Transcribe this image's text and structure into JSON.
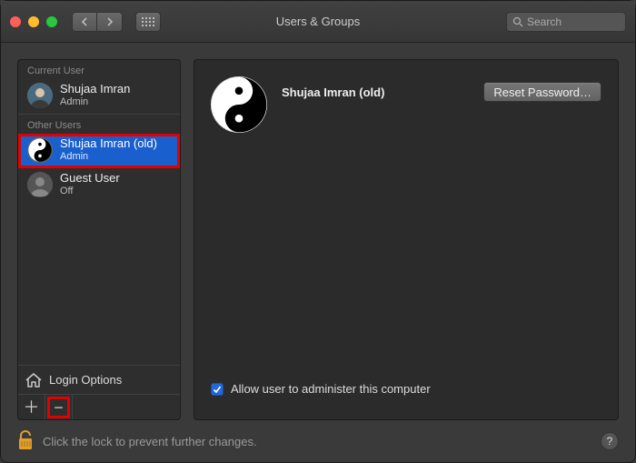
{
  "window": {
    "title": "Users & Groups"
  },
  "toolbar": {
    "search_placeholder": "Search"
  },
  "sidebar": {
    "current_header": "Current User",
    "other_header": "Other Users",
    "current_user": {
      "name": "Shujaa Imran",
      "role": "Admin"
    },
    "other_users": [
      {
        "name": "Shujaa Imran (old)",
        "role": "Admin",
        "selected": true
      },
      {
        "name": "Guest User",
        "role": "Off",
        "selected": false
      }
    ],
    "login_options": "Login Options"
  },
  "content": {
    "display_name": "Shujaa Imran (old)",
    "reset_button": "Reset Password…",
    "admin_checkbox_label": "Allow user to administer this computer",
    "admin_checkbox_checked": true
  },
  "footer": {
    "lock_text": "Click the lock to prevent further changes."
  }
}
